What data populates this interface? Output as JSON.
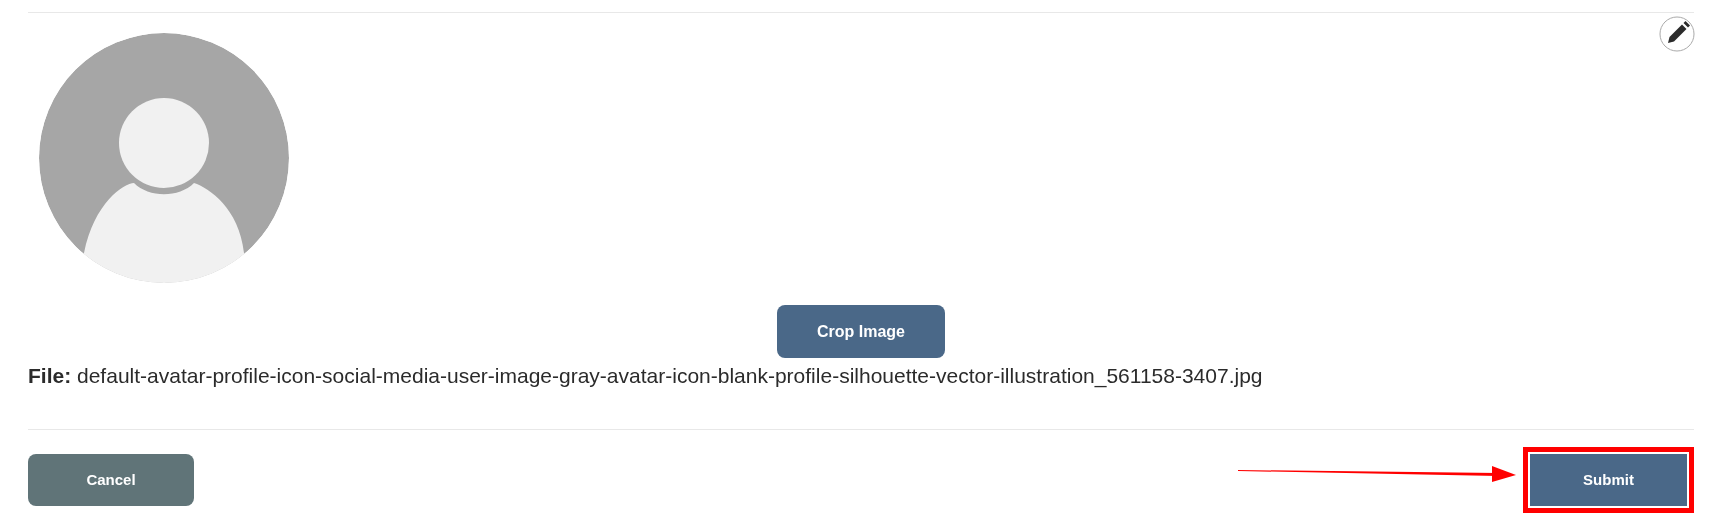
{
  "crop_button": "Crop Image",
  "file_line": "**File:** default-avatar-profile-icon-social-media-user-image-gray-avatar-icon-blank-profile-silhouette-vector-illustration_561158-3407.jpg",
  "buttons": [
    {
      "label": "Cancel",
      "kind": "secondary",
      "highlighted": false
    },
    {
      "label": "Submit",
      "kind": "primary",
      "highlighted": true
    }
  ]
}
